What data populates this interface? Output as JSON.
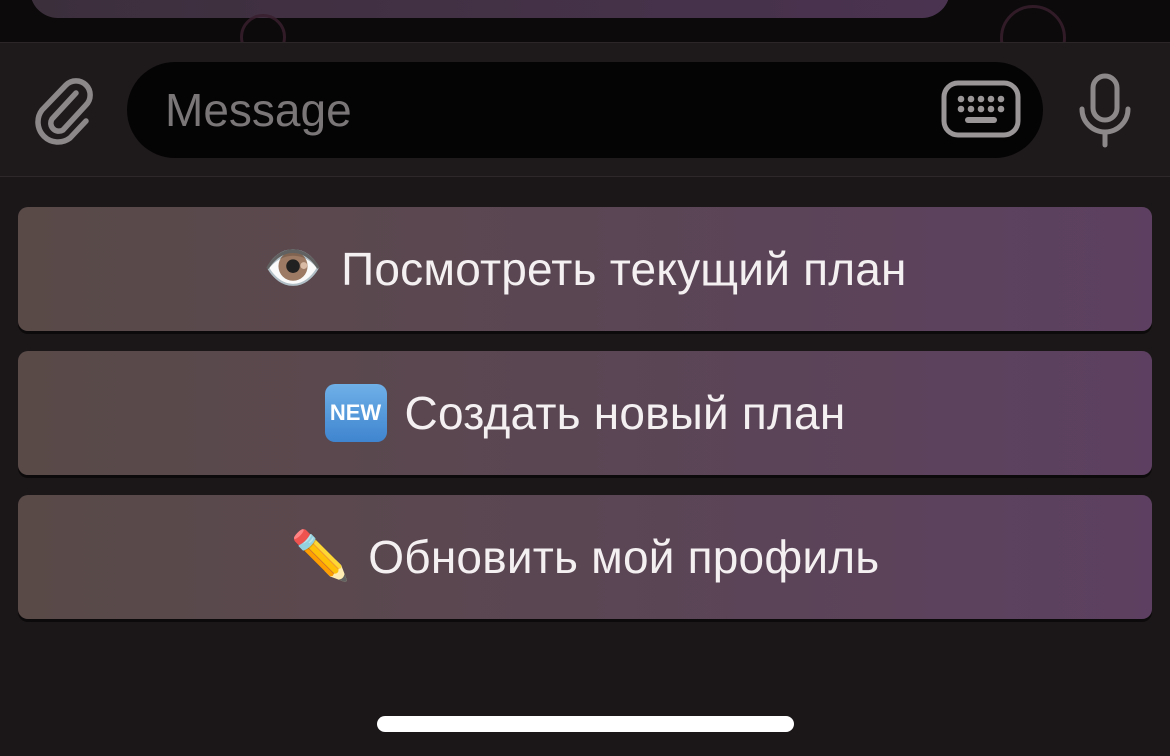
{
  "input_bar": {
    "placeholder": "Message",
    "value": "",
    "icons": {
      "attach": "paperclip-icon",
      "keyboard": "keyboard-icon",
      "mic": "microphone-icon"
    }
  },
  "reply_keyboard": {
    "buttons": [
      {
        "emoji": "👁️",
        "label": "Посмотреть текущий план"
      },
      {
        "emoji": "NEW",
        "label": "Создать новый план"
      },
      {
        "emoji": "✏️",
        "label": "Обновить мой профиль"
      }
    ]
  },
  "colors": {
    "button_gradient_start": "#594a48",
    "button_gradient_end": "#5d4061",
    "background": "#1b1718",
    "input_field": "#050405"
  }
}
